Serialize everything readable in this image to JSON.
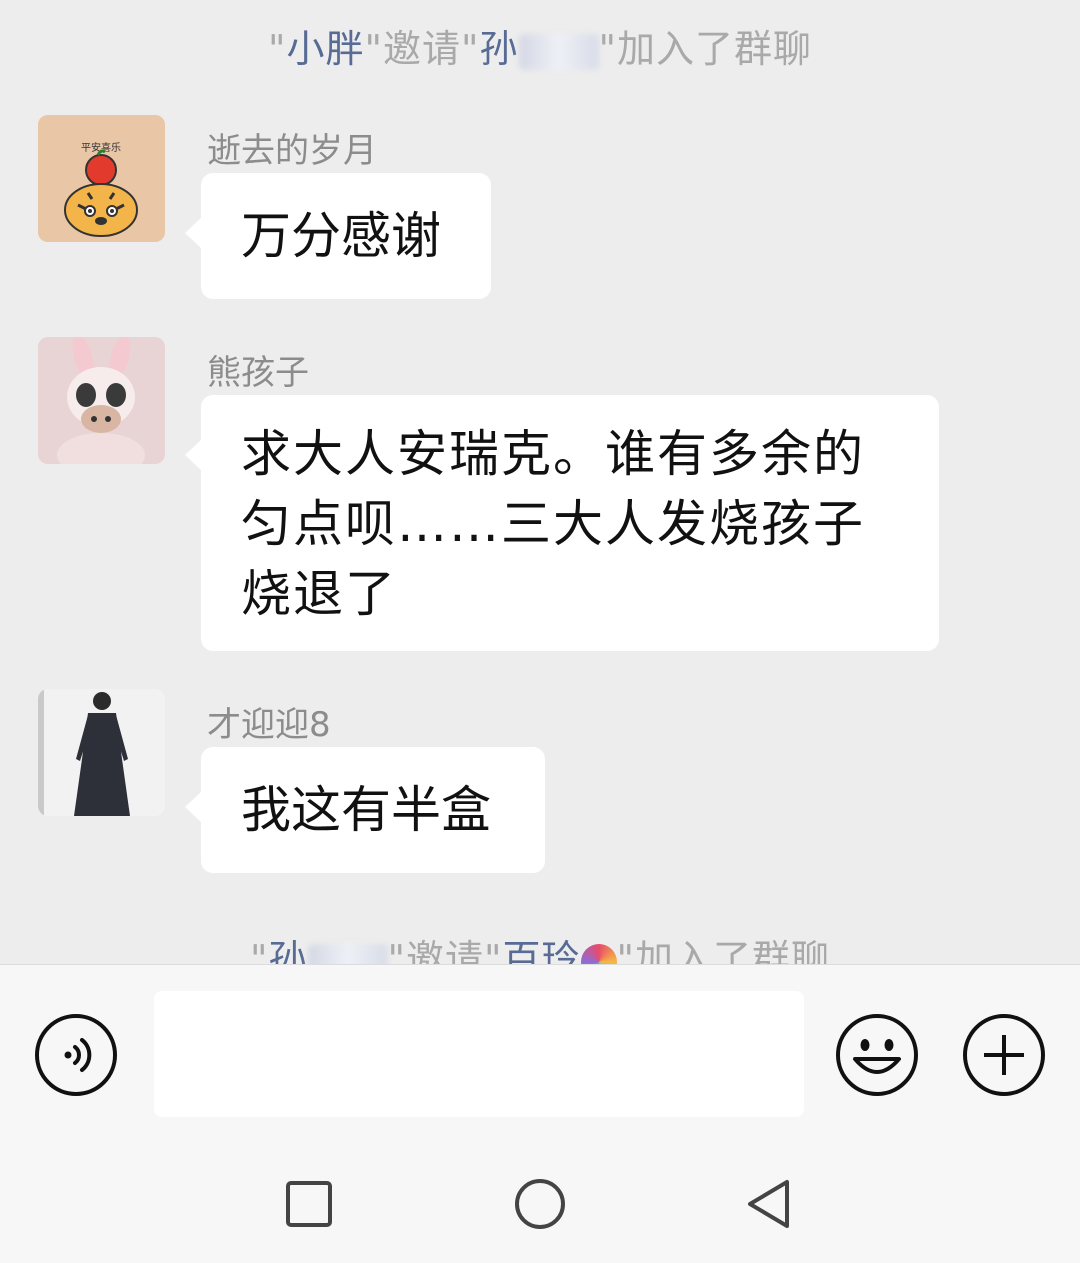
{
  "system_messages": [
    {
      "prefix": "\"",
      "inviter": "小胖",
      "middle": "\"邀请\"",
      "invitee": "孙",
      "suffix": "\"加入了群聊"
    },
    {
      "prefix": "\"",
      "inviter": "孙",
      "middle": "\"邀请\"",
      "invitee": "百玲",
      "suffix": "\"加入了群聊"
    }
  ],
  "messages": [
    {
      "sender": "逝去的岁月",
      "text": "万分感谢",
      "avatar": "tiger-sticker-avatar"
    },
    {
      "sender": "熊孩子",
      "lines": [
        "求大人安瑞克。谁有多余的",
        "匀点呗……三大人发烧孩子",
        "烧退了"
      ],
      "avatar": "bunny-doll-avatar"
    },
    {
      "sender": "才迎迎8",
      "text": "我这有半盒",
      "avatar": "person-photo-avatar"
    }
  ],
  "avatar_text": {
    "tiger_caption": "平安喜乐"
  },
  "input_bar": {
    "voice_icon": "voice-icon",
    "emoji_icon": "emoji-icon",
    "plus_icon": "plus-icon",
    "input_value": ""
  },
  "nav_bar": {
    "recents_icon": "square-icon",
    "home_icon": "circle-icon",
    "back_icon": "triangle-back-icon"
  },
  "colors": {
    "background": "#ededed",
    "bubble": "#ffffff",
    "system_name": "#576b95",
    "system_text": "#a9a9a9",
    "sender_text": "#8c8c8c"
  }
}
